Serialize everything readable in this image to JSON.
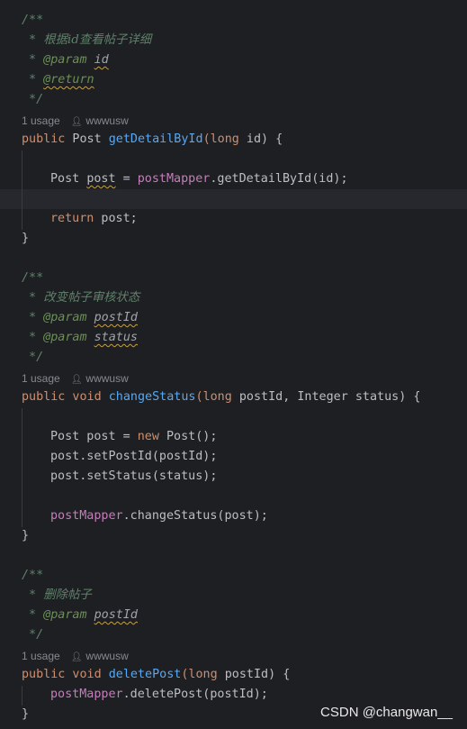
{
  "colors": {
    "background": "#1e1f22",
    "comment": "#5f826b",
    "keyword": "#cf8e6d",
    "function": "#56a8f5",
    "field": "#c77dbb",
    "text": "#bcbec4",
    "usage": "#868991"
  },
  "icons": {
    "author": "person-icon"
  },
  "method1": {
    "doc_open": "/**",
    "doc_desc_prefix": " * ",
    "doc_desc": "根据id查看帖子详细",
    "doc_param_prefix": " * ",
    "doc_param_tag": "@param",
    "doc_param_name": "id",
    "doc_return_prefix": " * ",
    "doc_return_tag": "@return",
    "doc_close": " */",
    "usage_count": "1 usage",
    "usage_author": "wwwusw",
    "sig_kw": "public",
    "sig_type": " Post ",
    "sig_name": "getDetailById",
    "sig_params_kw": "(long",
    "sig_params_rest": " id) {",
    "body1_type": "Post ",
    "body1_var": "post",
    "body1_eq": " = ",
    "body1_field": "postMapper",
    "body1_rest": ".getDetailById(id);",
    "body2_kw": "return",
    "body2_rest": " post;",
    "close": "}"
  },
  "method2": {
    "doc_open": "/**",
    "doc_desc_prefix": " * ",
    "doc_desc": "改变帖子审核状态",
    "doc_param1_prefix": " * ",
    "doc_param1_tag": "@param",
    "doc_param1_name": "postId",
    "doc_param2_prefix": " * ",
    "doc_param2_tag": "@param",
    "doc_param2_name": "status",
    "doc_close": " */",
    "usage_count": "1 usage",
    "usage_author": "wwwusw",
    "sig_kw": "public void",
    "sig_name": "changeStatus",
    "sig_params_kw": "(long",
    "sig_params_rest": " postId, Integer status) {",
    "body1_text": "Post post = ",
    "body1_kw": "new",
    "body1_rest": " Post();",
    "body2": "post.setPostId(postId);",
    "body3": "post.setStatus(status);",
    "body4_field": "postMapper",
    "body4_rest": ".changeStatus(post);",
    "close": "}"
  },
  "method3": {
    "doc_open": "/**",
    "doc_desc_prefix": " * ",
    "doc_desc": "删除帖子",
    "doc_param_prefix": " * ",
    "doc_param_tag": "@param",
    "doc_param_name": "postId",
    "doc_close": " */",
    "usage_count": "1 usage",
    "usage_author": "wwwusw",
    "sig_kw": "public void",
    "sig_name": "deletePost",
    "sig_params_kw": "(long",
    "sig_params_rest": " postId) {",
    "body1_field": "postMapper",
    "body1_rest": ".deletePost(postId);",
    "close": "}"
  },
  "watermark": "CSDN @changwan__"
}
